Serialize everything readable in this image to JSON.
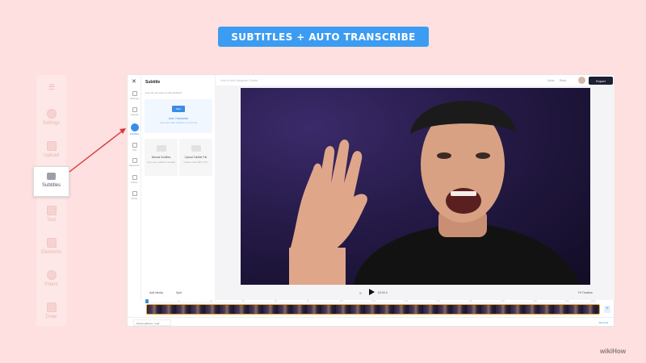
{
  "banner": "SUBTITLES + AUTO TRANSCRIBE",
  "ghost_sidebar": {
    "menu_icon": "hamburger-icon",
    "items": [
      {
        "label": "Settings",
        "icon": "gear-icon"
      },
      {
        "label": "Upload",
        "icon": "plus-icon"
      },
      {
        "label": "Subtitles",
        "icon": "subtitles-icon"
      },
      {
        "label": "Text",
        "icon": "text-icon"
      },
      {
        "label": "Elements",
        "icon": "elements-icon"
      },
      {
        "label": "Filters",
        "icon": "filters-icon"
      },
      {
        "label": "Draw",
        "icon": "pen-icon"
      }
    ]
  },
  "editor": {
    "close_glyph": "✕",
    "rail": [
      "Settings",
      "Upload",
      "Subtitles",
      "Text",
      "Elements",
      "Filters",
      "Draw"
    ],
    "panel_title": "Subtitle",
    "panel_hint": "How do you want to add subtitles?",
    "auto_button": "Start",
    "auto_title": "Auto Transcribe",
    "auto_sub": "Auto-generate subtitles in seconds",
    "manual_title": "Manual Subtitles",
    "manual_sub": "Type your subtitles manually",
    "upload_title": "Upload Subtitle File",
    "upload_sub": "Upload a file (SRT, VTT)",
    "project_name": "How to Add Instagram Stories",
    "undo": "Undo",
    "redo": "Redo",
    "export": "Export",
    "add_media": "Add Media",
    "split": "Split",
    "timecode": "00:00.0",
    "fit": "Fit Timeline",
    "ruler": [
      "0",
      "10",
      "20",
      "30",
      "40",
      "50",
      "1:00",
      "1:10",
      "1:20",
      "1:30",
      "1:40",
      "1:50",
      "2:00",
      "2:10",
      "2:20"
    ],
    "file_tab": "how-to-add-ins...mp4",
    "show_all": "Show All"
  },
  "watermark": "wikiHow"
}
